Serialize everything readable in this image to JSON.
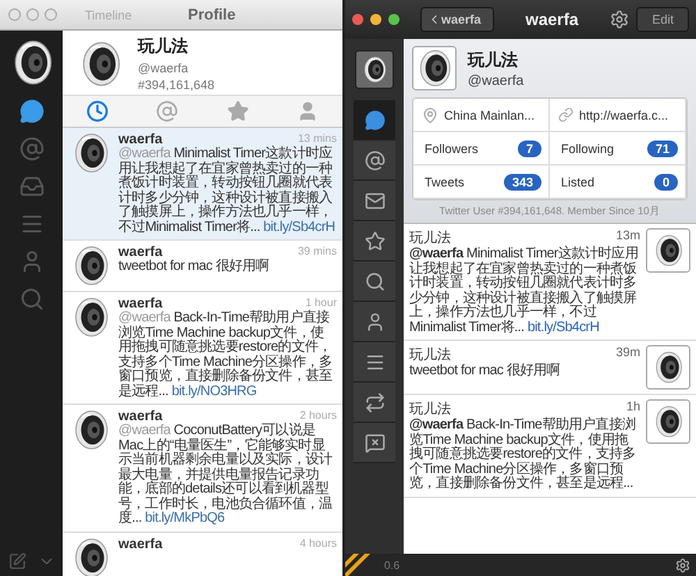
{
  "left_window": {
    "title_bar": {
      "breadcrumb": "Timeline",
      "title": "Profile"
    },
    "sidebar": [
      {
        "kind": "chat",
        "selected": true
      },
      {
        "kind": "at",
        "selected": false
      },
      {
        "kind": "inbox",
        "selected": false
      },
      {
        "kind": "list",
        "selected": false
      },
      {
        "kind": "person",
        "selected": false
      },
      {
        "kind": "search",
        "selected": false
      }
    ],
    "profile": {
      "name": "玩儿法",
      "handle": "@waerfa",
      "id": "#394,161,648"
    },
    "tabs": [
      {
        "kind": "clock",
        "selected": true
      },
      {
        "kind": "at",
        "selected": false
      },
      {
        "kind": "star",
        "selected": false
      },
      {
        "kind": "person",
        "selected": false
      }
    ],
    "tweets": [
      {
        "user": "waerfa",
        "time": "13 mins",
        "mention": "@waerfa",
        "text": " Minimalist Timer这款计时应用让我想起了在宜家曾热卖过的一种煮饭计时装置，转动按钮几圈就代表计时多少分钟，这种设计被直接搬入了触摸屏上，操作方法也几乎一样，不过Minimalist Timer将... ",
        "link": "bit.ly/Sb4crH",
        "selected": true
      },
      {
        "user": "waerfa",
        "time": "39 mins",
        "text": "tweetbot for mac 很好用啊",
        "selected": false
      },
      {
        "user": "waerfa",
        "time": "1 hour",
        "mention": "@waerfa",
        "text": " Back-In-Time帮助用户直接浏览Time Machine backup文件，使用拖拽可随意挑选要restore的文件，支持多个Time Machine分区操作，多窗口预览，直接删除备份文件，甚至是远程... ",
        "link": "bit.ly/NO3HRG",
        "selected": false
      },
      {
        "user": "waerfa",
        "time": "2 hours",
        "mention": "@waerfa",
        "text": " CoconutBattery可以说是Mac上的“电量医生”，它能够实时显示当前机器剩余电量以及实际，设计最大电量，并提供电量报告记录功能，底部的details还可以看到机器型号，工作时长，电池负合循环值，温度... ",
        "link": "bit.ly/MkPbQ6",
        "selected": false
      },
      {
        "user": "waerfa",
        "time": "4 hours",
        "selected": false
      }
    ]
  },
  "right_window": {
    "header": {
      "back": "waerfa",
      "title": "waerfa",
      "edit": "Edit"
    },
    "sidebar": [
      {
        "kind": "account",
        "selected": true
      },
      {
        "kind": "chat",
        "selected": true
      },
      {
        "kind": "at",
        "selected": false
      },
      {
        "kind": "mail",
        "selected": false
      },
      {
        "kind": "star",
        "selected": false
      },
      {
        "kind": "search",
        "selected": false
      },
      {
        "kind": "person",
        "selected": false
      },
      {
        "kind": "list",
        "selected": false
      },
      {
        "kind": "retweet",
        "selected": false
      },
      {
        "kind": "mute",
        "selected": false
      }
    ],
    "profile": {
      "name": "玩儿法",
      "handle": "@waerfa",
      "location": "China Mainlan...",
      "url": "http://waerfa.c...",
      "stats": [
        {
          "label": "Followers",
          "count": "7"
        },
        {
          "label": "Following",
          "count": "71"
        },
        {
          "label": "Tweets",
          "count": "343"
        },
        {
          "label": "Listed",
          "count": "0"
        }
      ],
      "footer": "Twitter User #394,161,648. Member Since 10月"
    },
    "tweets": [
      {
        "name": "玩儿法",
        "time": "13m",
        "mention": "@waerfa",
        "text": " Minimalist Timer这款计时应用让我想起了在宜家曾热卖过的一种煮饭计时装置，转动按钮几圈就代表计时多少分钟，这种设计被直接搬入了触摸屏上，操作方法也几乎一样，不过Minimalist Timer将... ",
        "link": "bit.ly/Sb4crH"
      },
      {
        "name": "玩儿法",
        "time": "39m",
        "text": "tweetbot for mac 很好用啊"
      },
      {
        "name": "玩儿法",
        "time": "1h",
        "mention": "@waerfa",
        "text": " Back-In-Time帮助用户直接浏览Time Machine backup文件，使用拖拽可随意挑选要restore的文件，支持多个Time Machine分区操作，多窗口预览，直接删除备份文件，甚至是远程..."
      }
    ],
    "status_bar": {
      "version": "0.6"
    }
  }
}
